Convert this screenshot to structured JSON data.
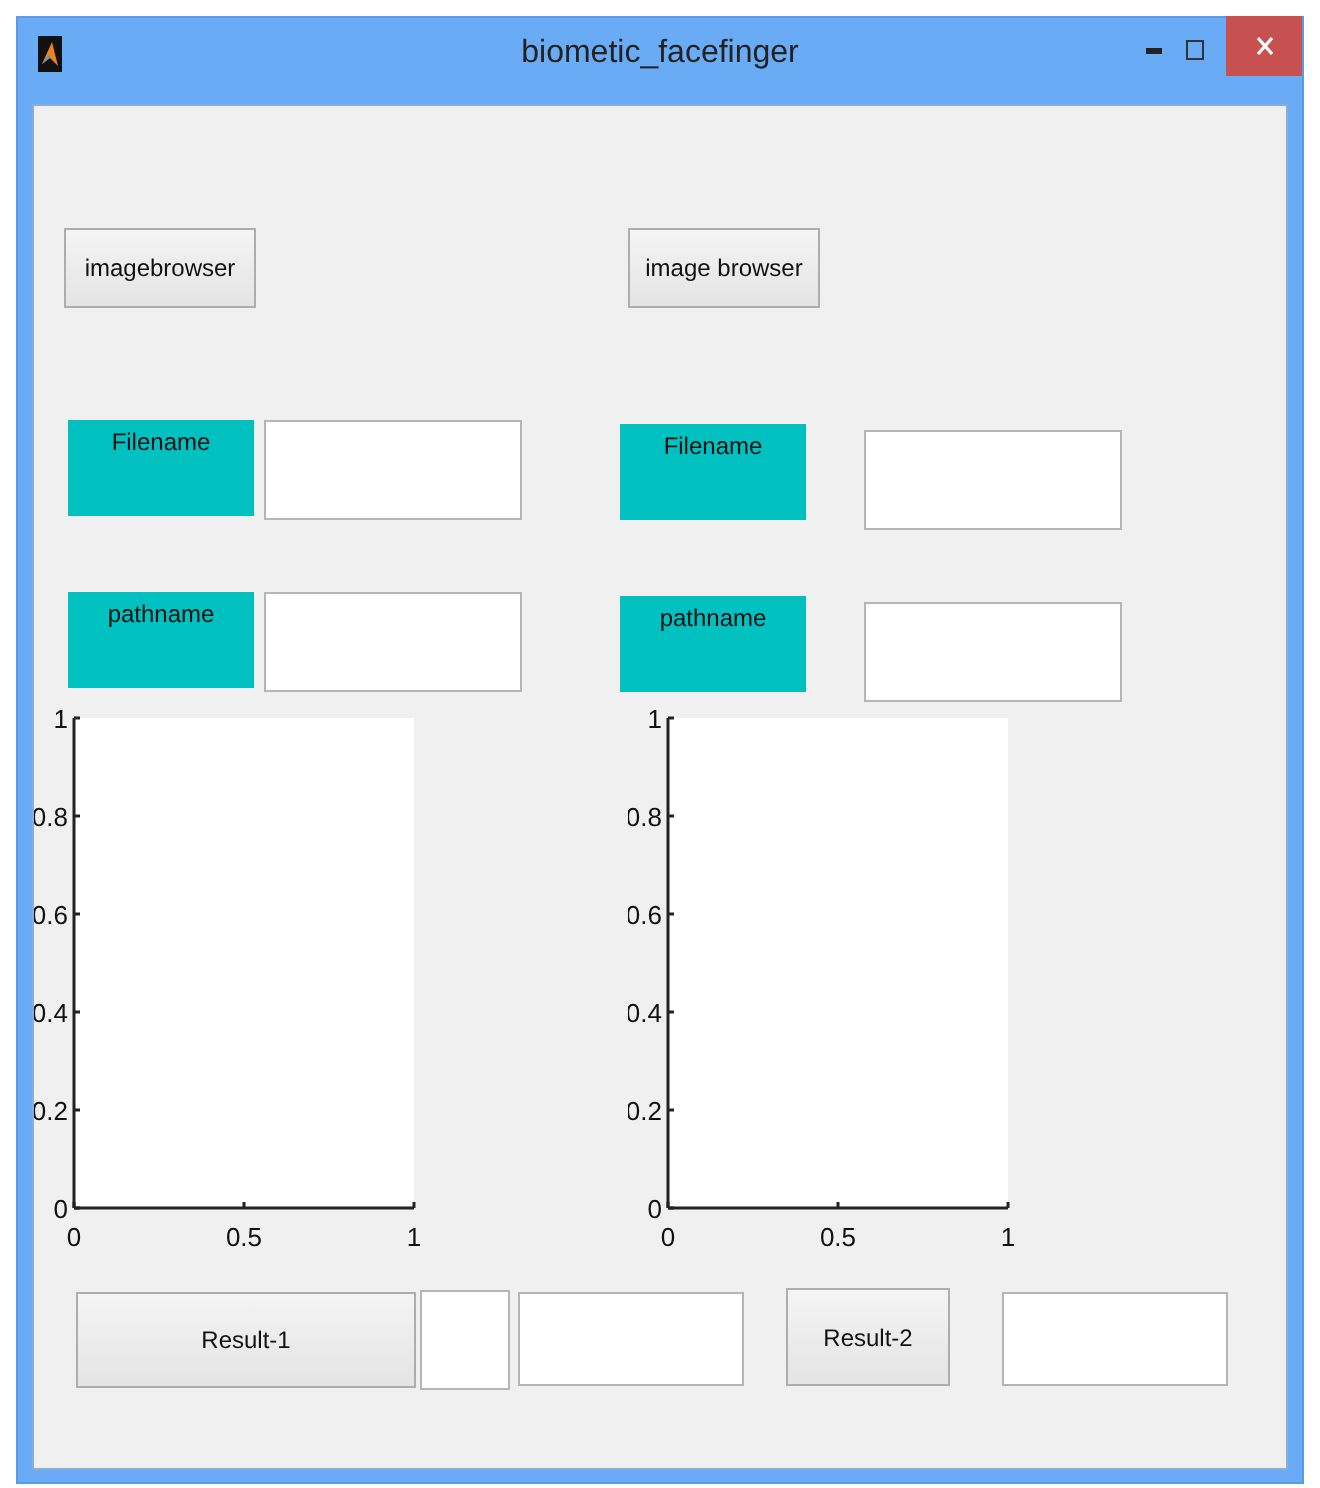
{
  "window": {
    "title": "biometic_facefinger"
  },
  "panels": [
    {
      "browse_button": "imagebrowser",
      "fields": [
        {
          "label": "Filename"
        },
        {
          "label": "pathname"
        }
      ],
      "chart_data": {
        "type": "line",
        "xlim": [
          0,
          1
        ],
        "ylim": [
          0,
          1
        ],
        "xticks": [
          0,
          0.5,
          1
        ],
        "yticks": [
          0,
          0.2,
          0.4,
          0.6,
          0.8,
          1
        ]
      }
    },
    {
      "browse_button": "image browser",
      "fields": [
        {
          "label": "Filename"
        },
        {
          "label": "pathname"
        }
      ],
      "chart_data": {
        "type": "line",
        "xlim": [
          0,
          1
        ],
        "ylim": [
          0,
          1
        ],
        "xticks": [
          0,
          0.5,
          1
        ],
        "yticks": [
          0,
          0.2,
          0.4,
          0.6,
          0.8,
          1
        ]
      }
    }
  ],
  "results": [
    {
      "button": "Result-1"
    },
    {
      "button": "Result-2"
    }
  ]
}
